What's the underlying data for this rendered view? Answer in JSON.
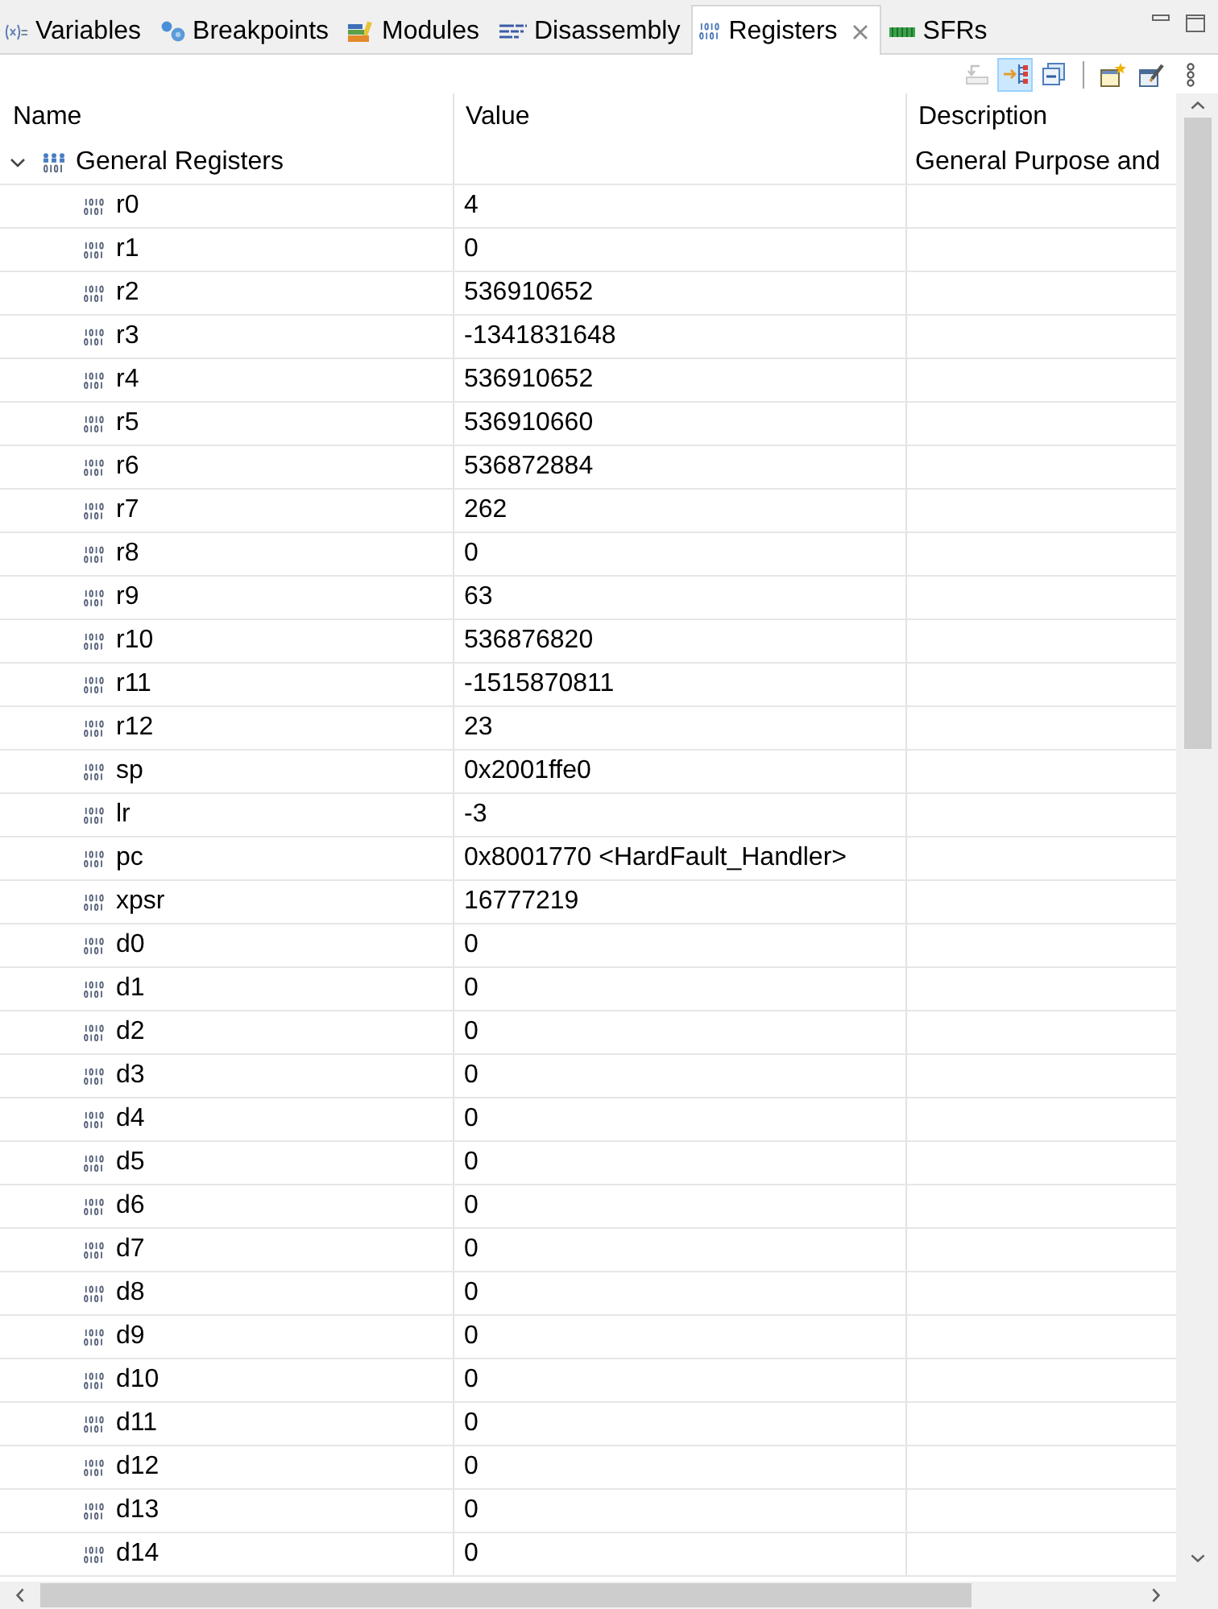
{
  "tabs": [
    {
      "kind": "variables",
      "label": "Variables",
      "selected": false
    },
    {
      "kind": "breakpoints",
      "label": "Breakpoints",
      "selected": false
    },
    {
      "kind": "modules",
      "label": "Modules",
      "selected": false
    },
    {
      "kind": "disassembly",
      "label": "Disassembly",
      "selected": false
    },
    {
      "kind": "registers",
      "label": "Registers",
      "selected": true
    },
    {
      "kind": "sfrs",
      "label": "SFRs",
      "selected": false
    }
  ],
  "toolbar": [
    {
      "buttons": [
        {
          "kind": "restore",
          "disabled": true,
          "pressed": false
        },
        {
          "kind": "layout",
          "disabled": false,
          "pressed": true
        },
        {
          "kind": "collapse",
          "disabled": false,
          "pressed": false
        }
      ]
    },
    {
      "buttons": [
        {
          "kind": "add-group",
          "disabled": false,
          "pressed": false
        },
        {
          "kind": "edit-group",
          "disabled": false,
          "pressed": false
        },
        {
          "kind": "menu",
          "disabled": false,
          "pressed": false
        }
      ]
    }
  ],
  "table": {
    "columns": [
      "Name",
      "Value",
      "Description"
    ],
    "rows": [
      {
        "name": "General Registers",
        "description": "General Purpose and",
        "expanded": true,
        "children": [
          {
            "name": "r0",
            "value": "4"
          },
          {
            "name": "r1",
            "value": "0"
          },
          {
            "name": "r2",
            "value": "536910652"
          },
          {
            "name": "r3",
            "value": "-1341831648"
          },
          {
            "name": "r4",
            "value": "536910652"
          },
          {
            "name": "r5",
            "value": "536910660"
          },
          {
            "name": "r6",
            "value": "536872884"
          },
          {
            "name": "r7",
            "value": "262"
          },
          {
            "name": "r8",
            "value": "0"
          },
          {
            "name": "r9",
            "value": "63"
          },
          {
            "name": "r10",
            "value": "536876820"
          },
          {
            "name": "r11",
            "value": "-1515870811"
          },
          {
            "name": "r12",
            "value": "23"
          },
          {
            "name": "sp",
            "value": "0x2001ffe0"
          },
          {
            "name": "lr",
            "value": "-3"
          },
          {
            "name": "pc",
            "value": "0x8001770 <HardFault_Handler>"
          },
          {
            "name": "xpsr",
            "value": "16777219"
          },
          {
            "name": "d0",
            "value": "0"
          },
          {
            "name": "d1",
            "value": "0"
          },
          {
            "name": "d2",
            "value": "0"
          },
          {
            "name": "d3",
            "value": "0"
          },
          {
            "name": "d4",
            "value": "0"
          },
          {
            "name": "d5",
            "value": "0"
          },
          {
            "name": "d6",
            "value": "0"
          },
          {
            "name": "d7",
            "value": "0"
          },
          {
            "name": "d8",
            "value": "0"
          },
          {
            "name": "d9",
            "value": "0"
          },
          {
            "name": "d10",
            "value": "0"
          },
          {
            "name": "d11",
            "value": "0"
          },
          {
            "name": "d12",
            "value": "0"
          },
          {
            "name": "d13",
            "value": "0"
          },
          {
            "name": "d14",
            "value": "0"
          }
        ]
      }
    ]
  }
}
